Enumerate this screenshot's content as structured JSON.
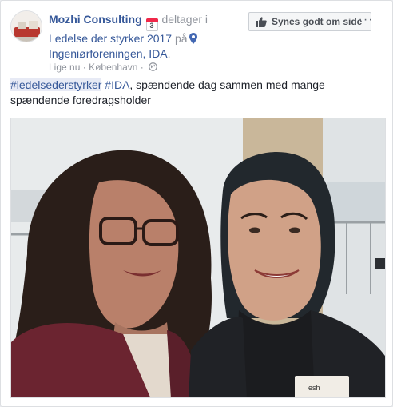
{
  "post": {
    "page_name": "Mozhi Consulting",
    "calendar_day": "3",
    "action_text": "deltager i",
    "event_name": "Ledelse der styrker 2017",
    "on_text": "på",
    "location_name": "Ingeniørforeningen, IDA",
    "period": ".",
    "timestamp": "Lige nu",
    "separator": "·",
    "city": "København",
    "privacy_icon": "globe-icon",
    "hashtag1": "#ledelsederstyrker",
    "hashtag2": "#IDA",
    "body_text": ", spændende dag sammen med mange spændende foredragsholder",
    "badge_text": "esh"
  },
  "actions": {
    "like_page_label": "Synes godt om side",
    "like_icon": "thumbs-up-icon",
    "more_label": "···"
  },
  "colors": {
    "link": "#365899",
    "muted": "#90949c",
    "text": "#1d2129",
    "button_bg": "#f5f6f7",
    "calendar_red": "#f02849"
  }
}
